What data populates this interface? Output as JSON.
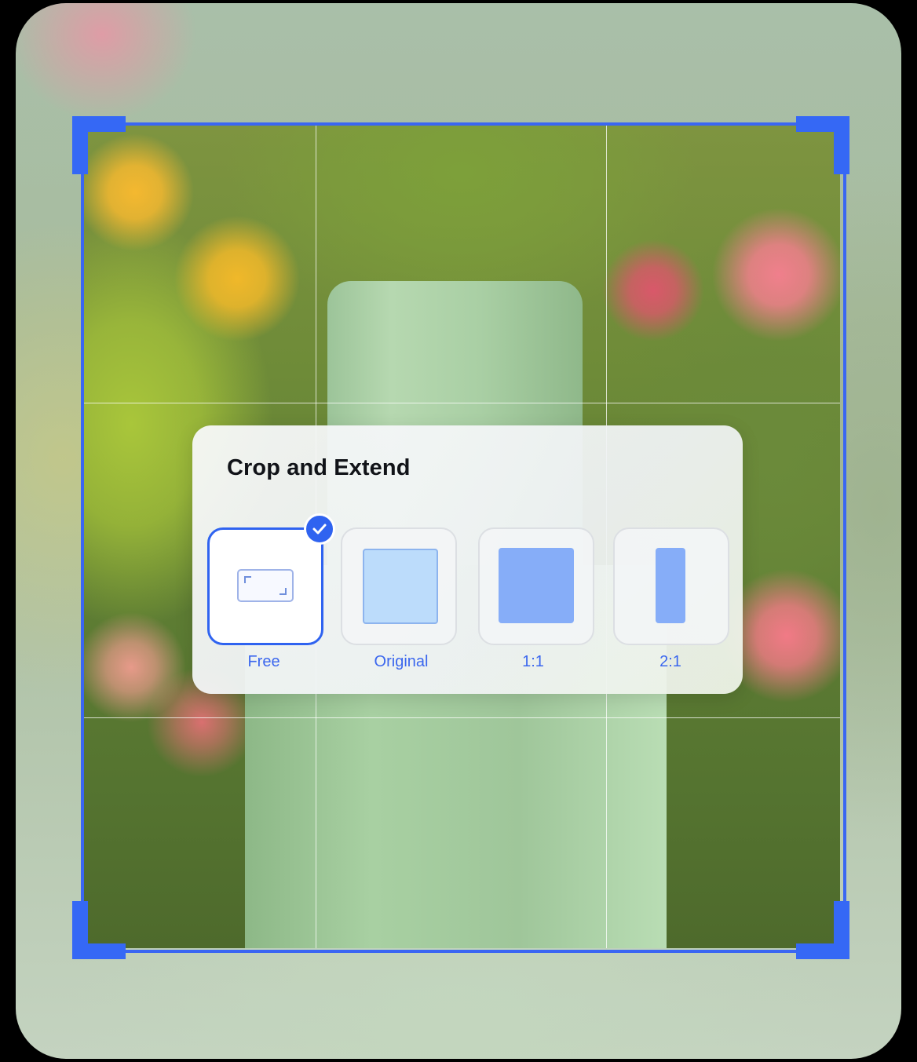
{
  "crop_panel": {
    "title": "Crop and Extend",
    "options": [
      {
        "label": "Free",
        "icon": "free-crop-icon",
        "selected": true
      },
      {
        "label": "Original",
        "icon": "original-ratio-icon",
        "selected": false
      },
      {
        "label": "1:1",
        "icon": "square-ratio-icon",
        "selected": false
      },
      {
        "label": "2:1",
        "icon": "portrait-ratio-icon",
        "selected": false
      }
    ],
    "selected_icon": "checkmark-icon"
  },
  "colors": {
    "accent": "#2f63f0",
    "crop_frame": "#3a66f2",
    "label": "#3b67ee"
  }
}
